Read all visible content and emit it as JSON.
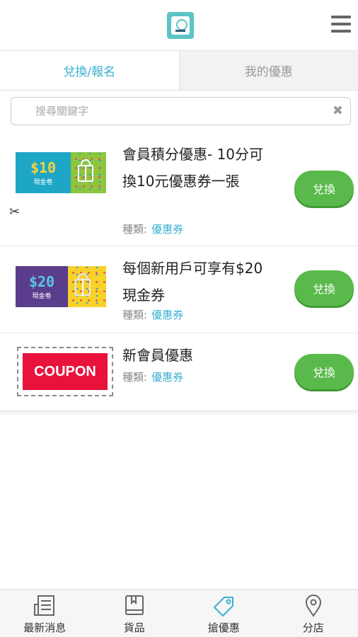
{
  "header": {
    "logo_icon": "app-logo",
    "menu_icon": "hamburger-icon"
  },
  "tabs": [
    {
      "label": "兌換/報名",
      "active": true
    },
    {
      "label": "我的優惠",
      "active": false
    }
  ],
  "search": {
    "placeholder": "搜尋關鍵字",
    "value": "",
    "clear_icon": "✖"
  },
  "items": [
    {
      "title": "會員積分優惠- 10分可換10元優惠券一張",
      "category_label": "種類:",
      "category_value": "優惠券",
      "image": {
        "amount": "$10",
        "caption": "現金卷",
        "left_color": "#1ea6c7",
        "right_color": "#8cc63f",
        "amount_color": "#f5d33b"
      },
      "button": "兌換"
    },
    {
      "title": "每個新用戶可享有$20現金券",
      "category_label": "種類:",
      "category_value": "優惠券",
      "image": {
        "amount": "$20",
        "caption": "現金卷",
        "left_color": "#5a3d8c",
        "right_color": "#f7d229",
        "amount_color": "#5bc8e0"
      },
      "button": "兌換"
    },
    {
      "title": "新會員優惠",
      "category_label": "種類:",
      "category_value": "優惠券",
      "image": {
        "text": "COUPON",
        "color": "#e8123c",
        "icon": "scissors-icon"
      },
      "button": "兌換"
    }
  ],
  "bottom_nav": [
    {
      "label": "最新消息",
      "icon": "newspaper-icon"
    },
    {
      "label": "貨品",
      "icon": "book-icon"
    },
    {
      "label": "搶優惠",
      "icon": "tag-icon",
      "active_color": "#3ab0d0"
    },
    {
      "label": "分店",
      "icon": "location-pin-icon"
    }
  ]
}
